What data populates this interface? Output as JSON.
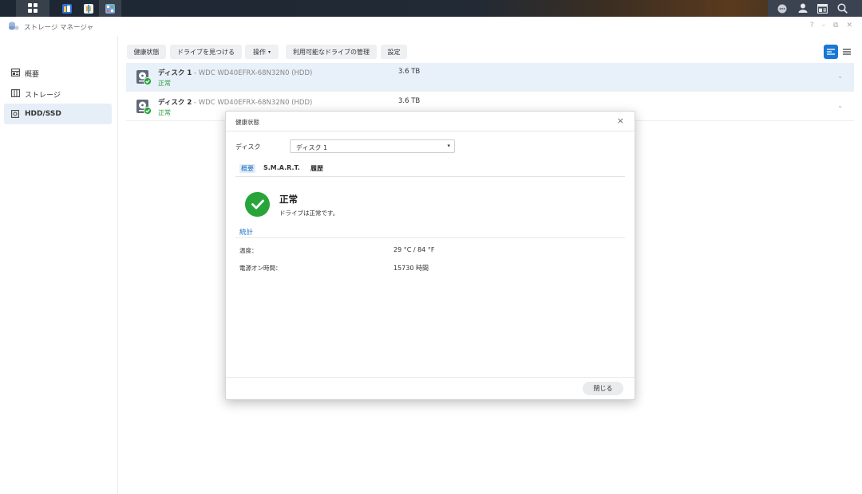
{
  "app": {
    "title": "ストレージ マネージャ"
  },
  "window_controls": {
    "help": "?",
    "minimize": "–",
    "restore": "⧉",
    "close": "✕"
  },
  "sidebar": {
    "items": [
      {
        "label": "概要",
        "icon": "overview-icon"
      },
      {
        "label": "ストレージ",
        "icon": "storage-icon"
      },
      {
        "label": "HDD/SSD",
        "icon": "drive-icon"
      }
    ]
  },
  "toolbar": {
    "health_label": "健康状態",
    "locate_label": "ドライブを見つける",
    "action_label": "操作",
    "manage_label": "利用可能なドライブの管理",
    "settings_label": "設定"
  },
  "disks": [
    {
      "name": "ディスク 1",
      "model": " - WDC WD40EFRX-68N32N0 (HDD)",
      "status": "正常",
      "size": "3.6 TB"
    },
    {
      "name": "ディスク 2",
      "model": " - WDC WD40EFRX-68N32N0 (HDD)",
      "status": "正常",
      "size": "3.6 TB"
    }
  ],
  "dialog": {
    "title": "健康状態",
    "disk_label": "ディスク",
    "disk_selected": "ディスク 1",
    "tabs": [
      "概要",
      "S.M.A.R.T.",
      "履歴"
    ],
    "status_title": "正常",
    "status_desc": "ドライブは正常です。",
    "section_title": "統計",
    "stats": [
      {
        "label": "温度：",
        "value": "29 °C / 84 °F"
      },
      {
        "label": "電源オン時間：",
        "value": "15730 時間"
      }
    ],
    "close_label": "閉じる"
  },
  "colors": {
    "accent": "#1a6fc4",
    "ok": "#27a53a",
    "selected_row": "#e8f0fa"
  }
}
